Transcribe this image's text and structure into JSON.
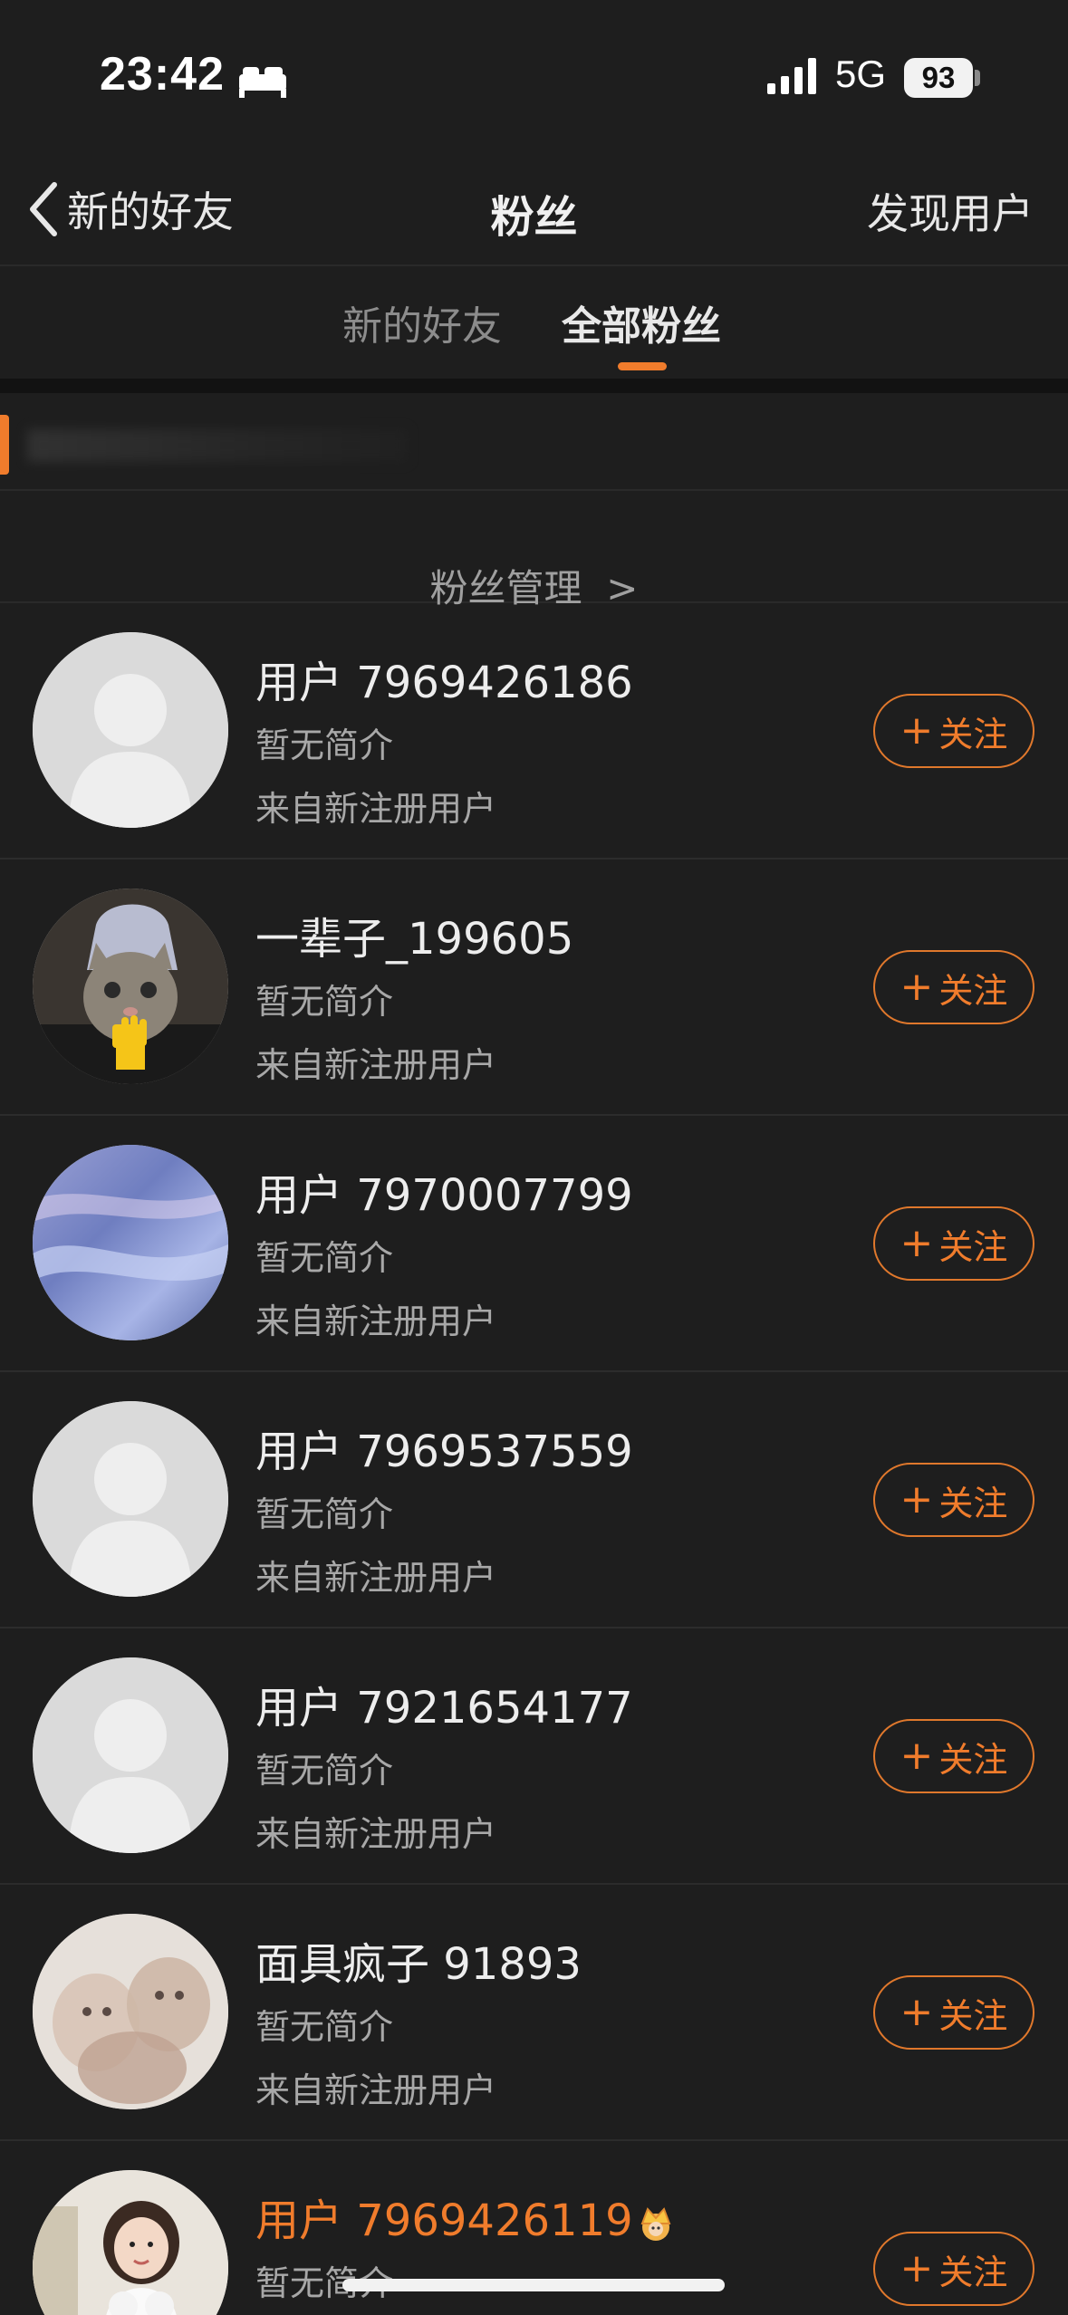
{
  "status_bar": {
    "time": "23:42",
    "network": "5G",
    "battery": "93"
  },
  "nav": {
    "back_label": "新的好友",
    "title": "粉丝",
    "right_label": "发现用户"
  },
  "tabs": [
    {
      "label": "新的好友",
      "active": false
    },
    {
      "label": "全部粉丝",
      "active": true
    }
  ],
  "manage": {
    "label": "粉丝管理",
    "chevron": ">"
  },
  "follow_label": "关注",
  "accent_color": "#f07c2c",
  "followers": [
    {
      "name": "用户 7969426186",
      "intro": "暂无简介",
      "source": "来自新注册用户",
      "avatar": "default-avatar"
    },
    {
      "name": "一辈子_199605",
      "intro": "暂无简介",
      "source": "来自新注册用户",
      "avatar": "cat-avatar"
    },
    {
      "name": "用户 7970007799",
      "intro": "暂无简介",
      "source": "来自新注册用户",
      "avatar": "blue-marble-avatar"
    },
    {
      "name": "用户 7969537559",
      "intro": "暂无简介",
      "source": "来自新注册用户",
      "avatar": "default-avatar"
    },
    {
      "name": "用户 7921654177",
      "intro": "暂无简介",
      "source": "来自新注册用户",
      "avatar": "default-avatar"
    },
    {
      "name": "面具疯子 91893",
      "intro": "暂无简介",
      "source": "来自新注册用户",
      "avatar": "kittens-avatar"
    },
    {
      "name": "用户 7969426119",
      "intro": "暂无简介",
      "source": "",
      "avatar": "girl-with-dog-avatar",
      "vip": true
    }
  ]
}
